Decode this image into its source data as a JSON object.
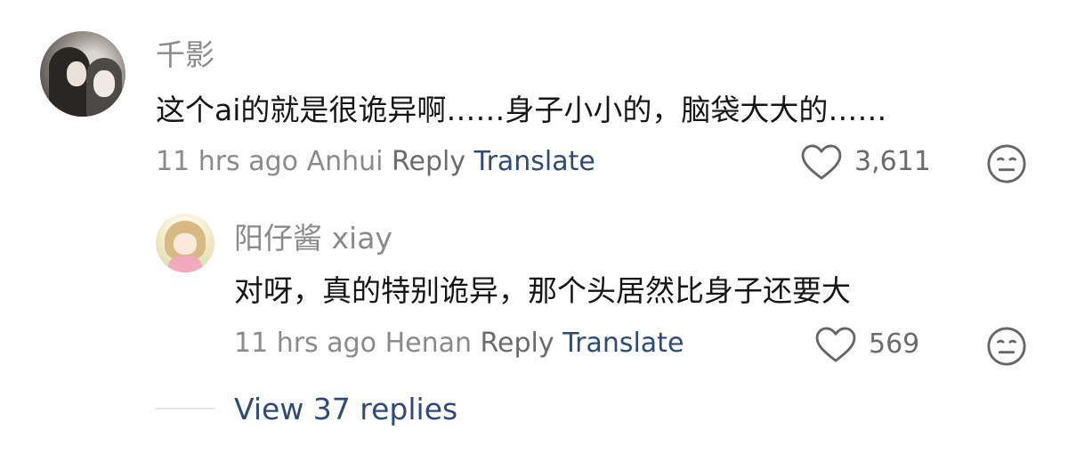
{
  "comments": [
    {
      "username": "千影",
      "text": "这个ai的就是很诡异啊……身子小小的，脑袋大大的……",
      "time": "11 hrs ago",
      "location": "Anhui",
      "reply_label": "Reply",
      "translate_label": "Translate",
      "likes": "3,611"
    }
  ],
  "replies": [
    {
      "username": "阳仔酱 xiay",
      "text": "对呀，真的特别诡异，那个头居然比身子还要大",
      "time": "11 hrs ago",
      "location": "Henan",
      "reply_label": "Reply",
      "translate_label": "Translate",
      "likes": "569"
    }
  ],
  "view_replies": "View 37 replies",
  "icons": {
    "like": "heart-outline-icon",
    "react": "smiley-face-icon"
  },
  "colors": {
    "link_blue": "#2d4a78",
    "muted_gray": "#8a8a8a"
  }
}
